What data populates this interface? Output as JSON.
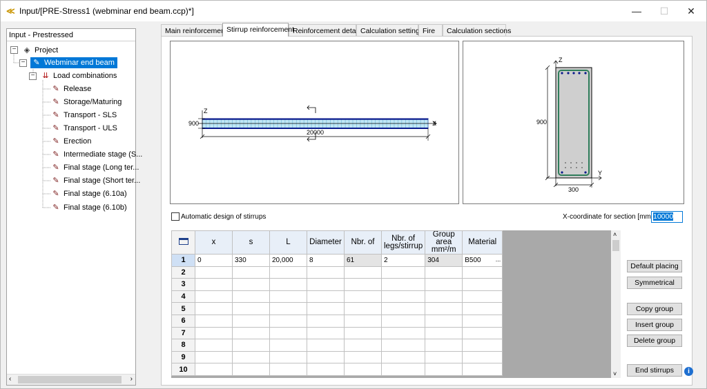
{
  "window": {
    "title": "Input/[PRE-Stress1 (webminar end beam.ccp)*]",
    "minimize": "—",
    "maximize": "☐",
    "close": "✕"
  },
  "tree": {
    "header": "Input - Prestressed",
    "project": "Project",
    "beam": "Webminar end beam",
    "load_combinations": "Load combinations",
    "items": [
      "Release",
      "Storage/Maturing",
      "Transport - SLS",
      "Transport - ULS",
      "Erection",
      "Intermediate stage (S...",
      "Final stage (Long ter...",
      "Final stage (Short ter...",
      "Final stage (6.10a)",
      "Final stage (6.10b)"
    ]
  },
  "tabs": [
    "Main reinforcement",
    "Stirrup reinforcement",
    "Reinforcement details",
    "Calculation settings",
    "Fire",
    "Calculation sections"
  ],
  "elevation": {
    "height": "900",
    "length": "20000",
    "z": "Z",
    "x": "X"
  },
  "section": {
    "height": "900",
    "width": "300",
    "z": "Z",
    "y": "Y"
  },
  "auto_design_label": "Automatic design of stirrups",
  "xcoord": {
    "label": "X-coordinate for section [mm]:",
    "value": "10000"
  },
  "grid": {
    "columns": [
      "x",
      "s",
      "L",
      "Diameter",
      "Nbr. of",
      "Nbr. of legs/stirrup",
      "Group area mm²/m",
      "Material"
    ],
    "row": [
      "0",
      "330",
      "20,000",
      "8",
      "61",
      "2",
      "304",
      "B500"
    ],
    "row_numbers": [
      "1",
      "2",
      "3",
      "4",
      "5",
      "6",
      "7",
      "8",
      "9",
      "10"
    ]
  },
  "buttons": {
    "default_placing": "Default placing",
    "symmetrical": "Symmetrical",
    "copy_group": "Copy group",
    "insert_group": "Insert group",
    "delete_group": "Delete group",
    "end_stirrups": "End stirrups"
  },
  "colors": {
    "selection": "#0078d7",
    "beam_fill": "#bfe6f5",
    "beam_edge": "#0a1a8c",
    "bar_green": "#2e7d5a"
  }
}
